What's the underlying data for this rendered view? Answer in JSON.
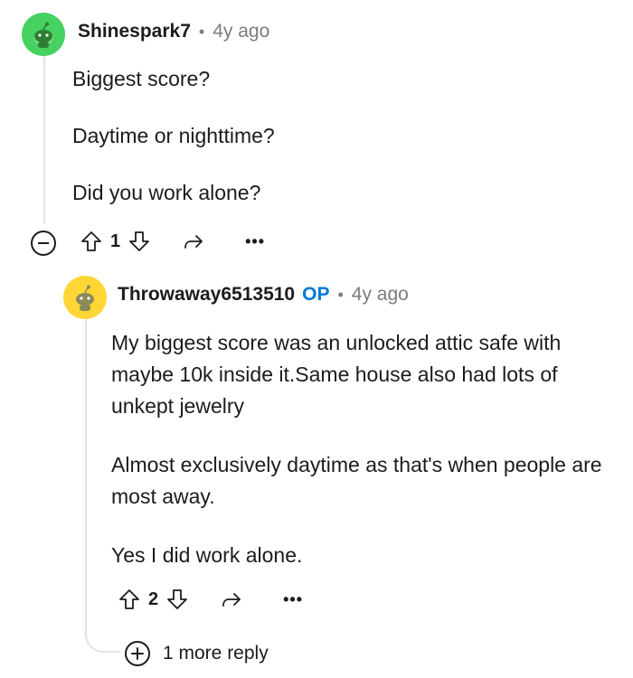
{
  "comments": [
    {
      "username": "Shinespark7",
      "separator": "•",
      "time": "4y ago",
      "avatar_color": "#46d160",
      "paragraphs": [
        "Biggest score?",
        "Daytime or nighttime?",
        "Did you work alone?"
      ],
      "vote_count": "1",
      "icons": [
        "collapse-icon",
        "upvote-icon",
        "downvote-icon",
        "share-icon",
        "more-options-icon"
      ],
      "more_label": "•••"
    },
    {
      "username": "Throwaway6513510",
      "op_label": "OP",
      "separator": "•",
      "time": "4y ago",
      "avatar_color": "#ffd635",
      "paragraphs": [
        "My biggest score was an unlocked attic safe with maybe 10k inside it.Same house also had lots of unkept jewelry",
        "Almost exclusively daytime as that's when people are most away.",
        "Yes I did work alone."
      ],
      "vote_count": "2",
      "icons": [
        "upvote-icon",
        "downvote-icon",
        "share-icon",
        "more-options-icon"
      ],
      "more_label": "•••"
    }
  ],
  "more_replies": {
    "label": "1 more reply",
    "icon": "plus-icon"
  },
  "colors": {
    "op": "#0079d3",
    "meta": "#7c7c7c",
    "thread_line": "#e1e3e5"
  }
}
